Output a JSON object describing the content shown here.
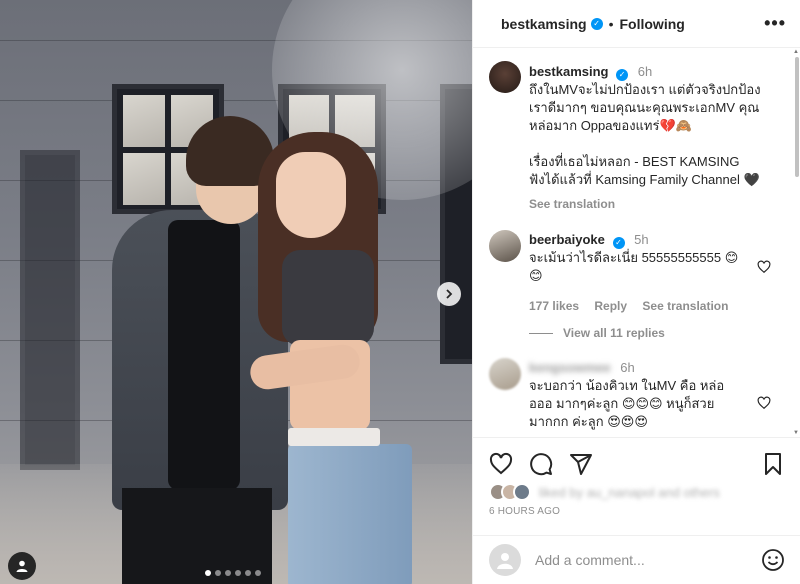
{
  "header": {
    "username": "bestkamsing",
    "separator": "•",
    "follow_status": "Following",
    "more_label": "•••"
  },
  "caption": {
    "username": "bestkamsing",
    "time": "6h",
    "text": "ถึงในMVจะไม่ปกป้องเรา แต่ตัวจริงปกป้อง\nเราดีมากๆ ขอบคุณนะคุณพระเอกMV คุณ\nหล่อมาก Oppaของแทร่💔🙈\n\nเรื่องที่เธอไม่หลอก - BEST KAMSING\nฟังได้แล้วที่ Kamsing Family Channel 🖤",
    "see_translation": "See translation"
  },
  "comments": [
    {
      "username": "beerbaiyoke",
      "time": "5h",
      "text": "จะเม้นว่าไรดีละเนี่ย 55555555555 😊\n😊",
      "likes": "177 likes",
      "reply": "Reply",
      "see_translation": "See translation",
      "view_replies": "View all 11 replies"
    },
    {
      "username": "kengsowmee",
      "time": "6h",
      "text": "จะบอกว่า น้องคิวเท ในMV คือ หล่อ\nอออ มากๆค่ะลูก 😊😊😊 หนูก็สวย\nมากกก ค่ะลูก 😍😍😍"
    }
  ],
  "likes_line": "liked by au_nanapol and others",
  "timestamp": "6 HOURS AGO",
  "add_comment": {
    "placeholder": "Add a comment..."
  },
  "colors": {
    "verified": "#0095f6",
    "muted": "#8e8e8e",
    "text": "#262626"
  },
  "icons": [
    "verified-badge-icon",
    "more-icon",
    "heart-icon",
    "comment-icon",
    "share-icon",
    "bookmark-icon",
    "emoji-icon",
    "chevron-right-icon",
    "user-tag-icon"
  ],
  "carousel": {
    "slides": 6,
    "current": 1
  }
}
